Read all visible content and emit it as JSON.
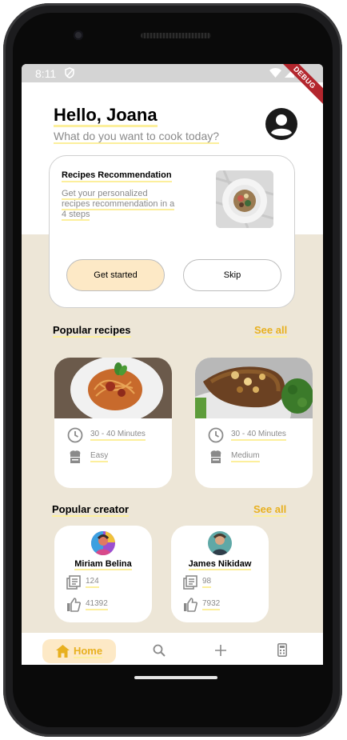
{
  "status_bar": {
    "time": "8:11",
    "debug_label": "DEBUG"
  },
  "header": {
    "greeting": "Hello, Joana",
    "subtitle": "What do you want to cook today?"
  },
  "recommendation": {
    "title": "Recipes Recommendation",
    "description": "Get your personalized recipes recommendation in a 4 steps",
    "start_label": "Get started",
    "skip_label": "Skip"
  },
  "popular_recipes": {
    "title": "Popular recipes",
    "see_all": "See all",
    "items": [
      {
        "time": "30 - 40 Minutes",
        "difficulty": "Easy"
      },
      {
        "time": "30 - 40 Minutes",
        "difficulty": "Medium"
      }
    ]
  },
  "popular_creator": {
    "title": "Popular creator",
    "see_all": "See all",
    "items": [
      {
        "name": "Miriam Belina",
        "recipes": "124",
        "likes": "41392"
      },
      {
        "name": "James Nikidaw",
        "recipes": "98",
        "likes": "7932"
      }
    ]
  },
  "bottom_nav": {
    "home_label": "Home",
    "items": [
      "home-icon",
      "search-icon",
      "add-icon",
      "calculator-icon"
    ]
  },
  "colors": {
    "accent": "#e8b01f",
    "highlight": "#fcef9c",
    "beige_background": "#ede6d7",
    "button_cream": "#fde9c6"
  }
}
